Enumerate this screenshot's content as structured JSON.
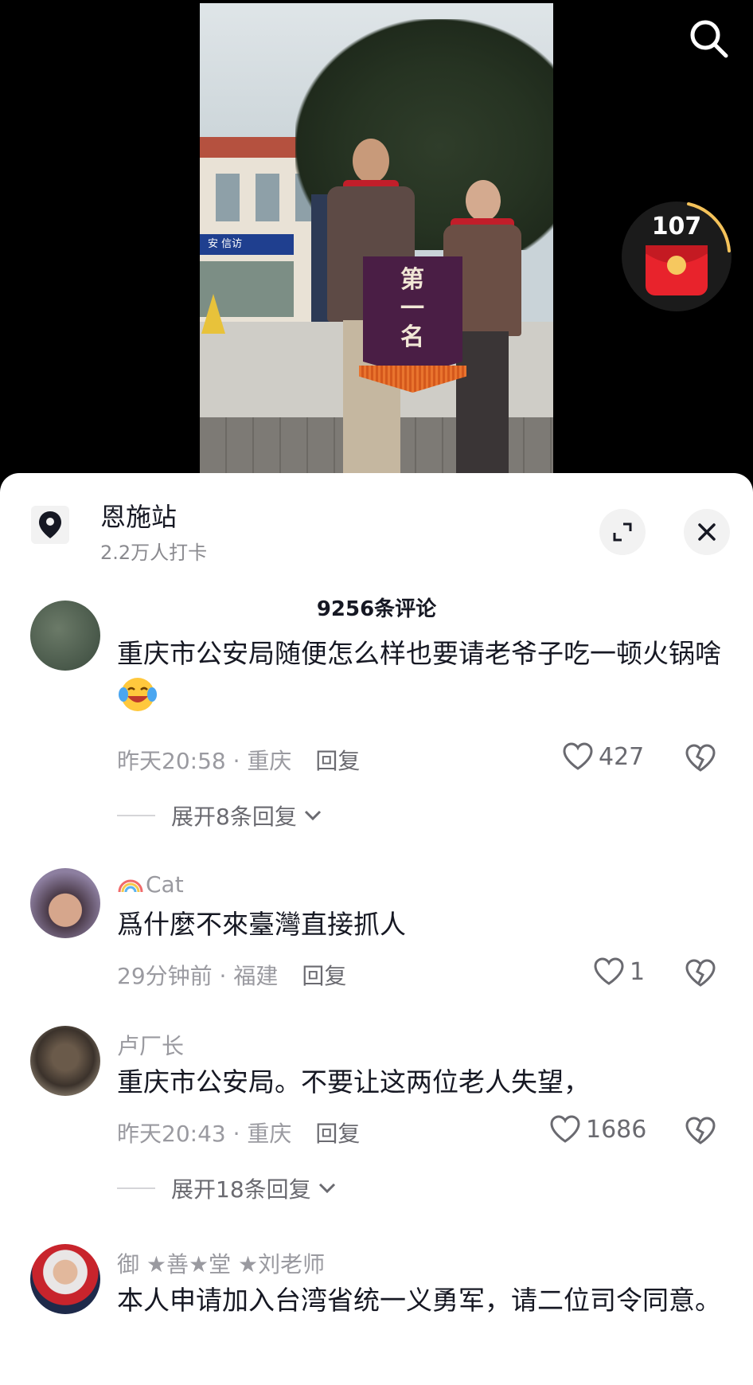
{
  "video": {
    "banner_text": "第一名",
    "sign_text": "安 信访",
    "red_packet_count": "107"
  },
  "panel": {
    "location_name": "恩施站",
    "location_checkins": "2.2万人打卡",
    "comment_count": "9256条评论"
  },
  "comments": [
    {
      "text": "重庆市公安局随便怎么样也要请老爷子吃一顿火锅啥",
      "time": "昨天20:58",
      "region": "重庆",
      "reply_label": "回复",
      "likes": "427",
      "expand_label": "展开8条回复"
    },
    {
      "username": "Cat",
      "text": "爲什麼不來臺灣直接抓人",
      "time": "29分钟前",
      "region": "福建",
      "reply_label": "回复",
      "likes": "1"
    },
    {
      "username": "卢厂长",
      "text": "重庆市公安局。不要让这两位老人失望，",
      "time": "昨天20:43",
      "region": "重庆",
      "reply_label": "回复",
      "likes": "1686",
      "expand_label": "展开18条回复"
    },
    {
      "username": "御 ★善★堂 ★刘老师",
      "text": "本人申请加入台湾省统一义勇军，请二位司令同意。"
    }
  ],
  "icons": {
    "search": "search-icon",
    "location": "location-pin-icon",
    "expand": "expand-icon",
    "close": "close-icon",
    "like": "heart-outline-icon",
    "dislike": "broken-heart-icon",
    "chevron": "chevron-down-icon"
  },
  "colors": {
    "red_packet": "#e8232c",
    "text_primary": "#161823",
    "text_secondary": "#9a9aa0"
  }
}
